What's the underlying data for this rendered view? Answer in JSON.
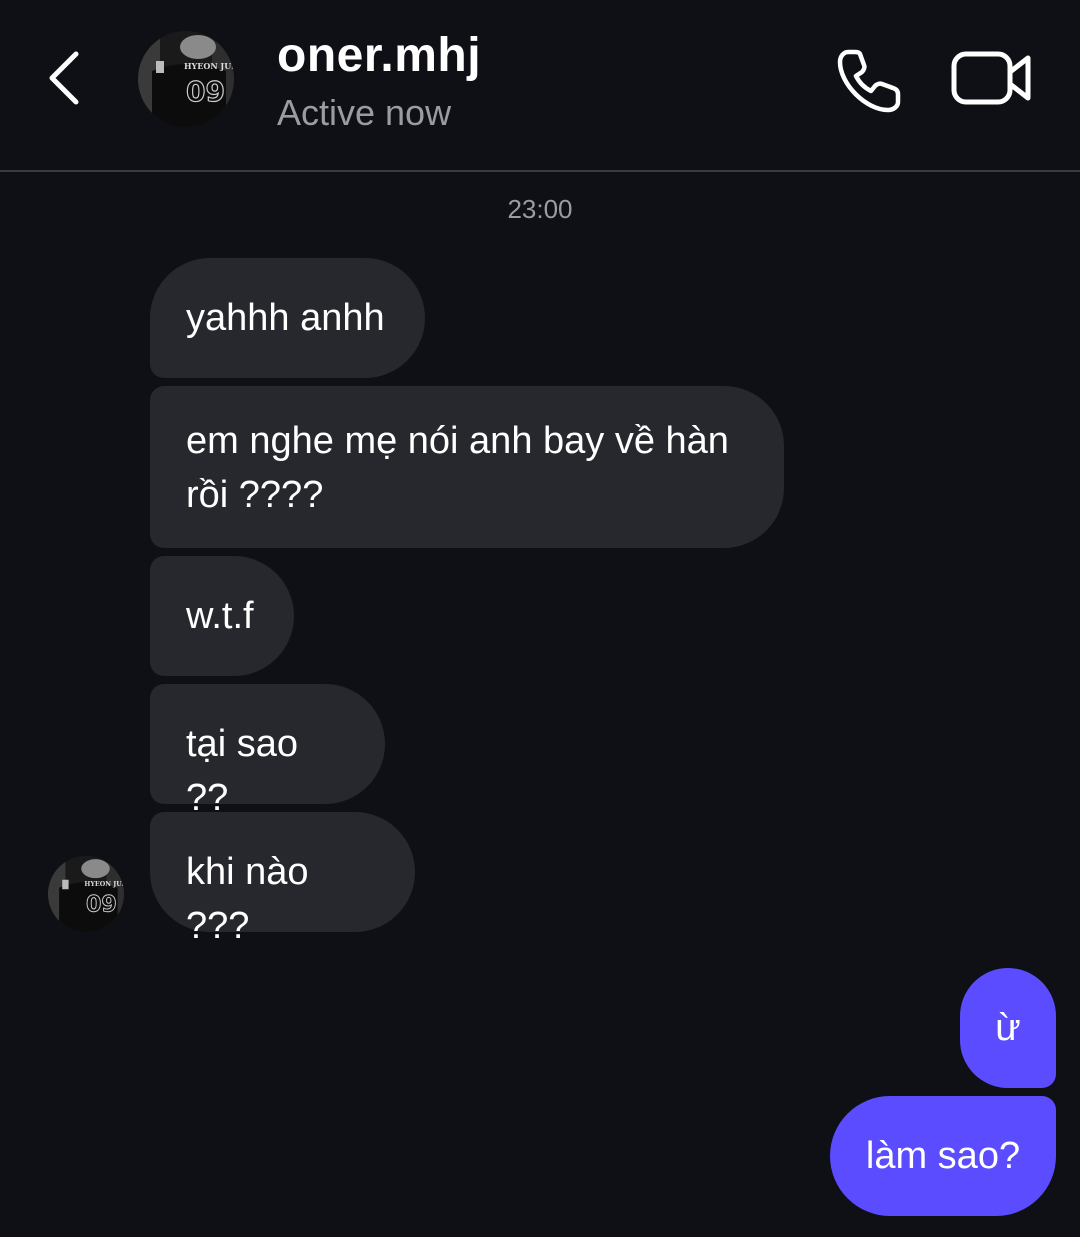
{
  "header": {
    "contact_name": "oner.mhj",
    "status": "Active now",
    "icons": [
      "back-icon",
      "phone-icon",
      "video-camera-icon"
    ]
  },
  "conversation": {
    "timestamp": "23:00",
    "messages": [
      {
        "direction": "incoming",
        "text": "yahhh anhh"
      },
      {
        "direction": "incoming",
        "text": "em nghe mẹ nói anh bay về hàn\nrồi ????"
      },
      {
        "direction": "incoming",
        "text": "w.t.f"
      },
      {
        "direction": "incoming",
        "text": "tại sao ??"
      },
      {
        "direction": "incoming",
        "text": "khi nào ???"
      },
      {
        "direction": "outgoing",
        "text": "ừ"
      },
      {
        "direction": "outgoing",
        "text": "làm sao?"
      }
    ]
  },
  "avatar": {
    "jersey_text": "HYEON JUN",
    "jersey_number": "09"
  },
  "colors": {
    "background": "#0f1016",
    "incoming_bubble": "#26282d",
    "outgoing_bubble": "#5b4cff",
    "secondary_text": "#9a9ba3"
  }
}
